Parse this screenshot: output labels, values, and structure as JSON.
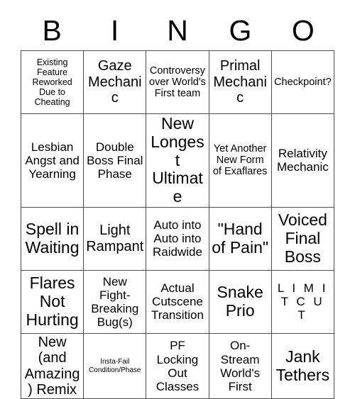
{
  "card": {
    "title_letters": [
      "B",
      "I",
      "N",
      "G",
      "O"
    ],
    "columns": 5,
    "rows": 5,
    "border_color": "#4d4d4d",
    "text_color": "#000000",
    "background_color": "#ffffff",
    "cells": [
      [
        {
          "text": "Existing Feature Reworked Due to Cheating",
          "size": "sm"
        },
        {
          "text": "Gaze Mechanic",
          "size": "xl"
        },
        {
          "text": "Controversy over World's First team",
          "size": "md"
        },
        {
          "text": "Primal Mechanic",
          "size": "xl"
        },
        {
          "text": "Checkpoint?",
          "size": "md"
        }
      ],
      [
        {
          "text": "Lesbian Angst and Yearning",
          "size": "lg"
        },
        {
          "text": "Double Boss Final Phase",
          "size": "lg"
        },
        {
          "text": "New Longest Ultimate",
          "size": "xxl"
        },
        {
          "text": "Yet Another New Form of Exaflares",
          "size": "md"
        },
        {
          "text": "Relativity Mechanic",
          "size": "lg"
        }
      ],
      [
        {
          "text": "Spell in Waiting",
          "size": "xxl"
        },
        {
          "text": "Light Rampant",
          "size": "xl"
        },
        {
          "text": "Auto into Auto into Raidwide",
          "size": "lg"
        },
        {
          "text": "\"Hand of Pain\"",
          "size": "xxl"
        },
        {
          "text": "Voiced Final Boss",
          "size": "xxl"
        }
      ],
      [
        {
          "text": "Flares Not Hurting",
          "size": "xxl"
        },
        {
          "text": "New Fight-Breaking Bug(s)",
          "size": "lg"
        },
        {
          "text": "Actual Cutscene Transition",
          "size": "lg"
        },
        {
          "text": "Snake Prio",
          "size": "xxl"
        },
        {
          "text": "L I M I T C U T",
          "size": "lg",
          "style": "spaced"
        }
      ],
      [
        {
          "text": "New (and Amazing) Remix",
          "size": "xl"
        },
        {
          "text": "Insta-Fail Condition/Phase",
          "size": "xs"
        },
        {
          "text": "PF Locking Out Classes",
          "size": "lg"
        },
        {
          "text": "On-Stream World's First",
          "size": "lg"
        },
        {
          "text": "Jank Tethers",
          "size": "xxl"
        }
      ]
    ]
  }
}
